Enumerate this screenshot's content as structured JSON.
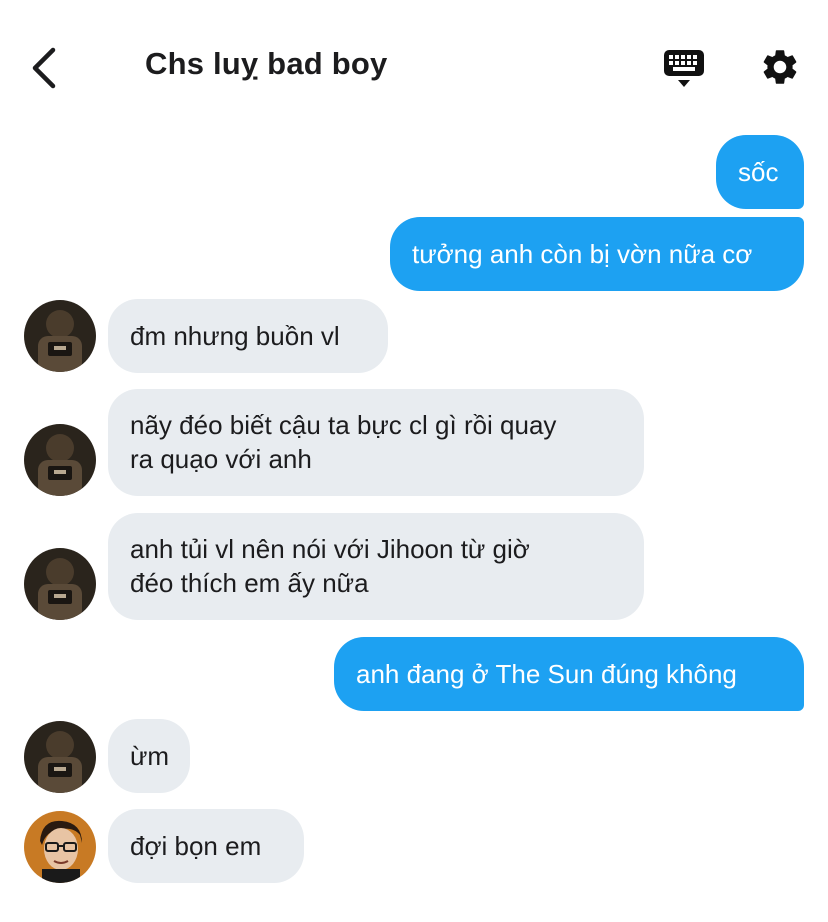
{
  "header": {
    "title": "Chs luỵ bad boy",
    "back_icon": "chevron-left-icon",
    "keyboard_icon": "keyboard-icon",
    "settings_icon": "gear-icon"
  },
  "colors": {
    "outgoing_bubble": "#1da1f2",
    "incoming_bubble": "#e8ecf0",
    "text_dark": "#1c1c1e"
  },
  "messages": [
    {
      "side": "out",
      "text": "sốc"
    },
    {
      "side": "out",
      "text": "tưởng anh còn bị vờn nữa cơ"
    },
    {
      "side": "in",
      "text": "đm nhưng buồn vl",
      "avatar": "dark-avatar"
    },
    {
      "side": "in",
      "text_lines": [
        "nãy đéo biết cậu ta bực cl gì rồi quay",
        "ra quạo với anh"
      ],
      "avatar": "dark-avatar"
    },
    {
      "side": "in",
      "text_lines": [
        "anh tủi vl nên nói với Jihoon từ giờ",
        "đéo thích em ấy nữa"
      ],
      "avatar": "dark-avatar"
    },
    {
      "side": "out",
      "text": "anh đang ở The Sun đúng không"
    },
    {
      "side": "in",
      "text": "ừm",
      "avatar": "dark-avatar"
    },
    {
      "side": "in",
      "text": "đợi bọn em",
      "avatar": "glasses-avatar"
    }
  ]
}
